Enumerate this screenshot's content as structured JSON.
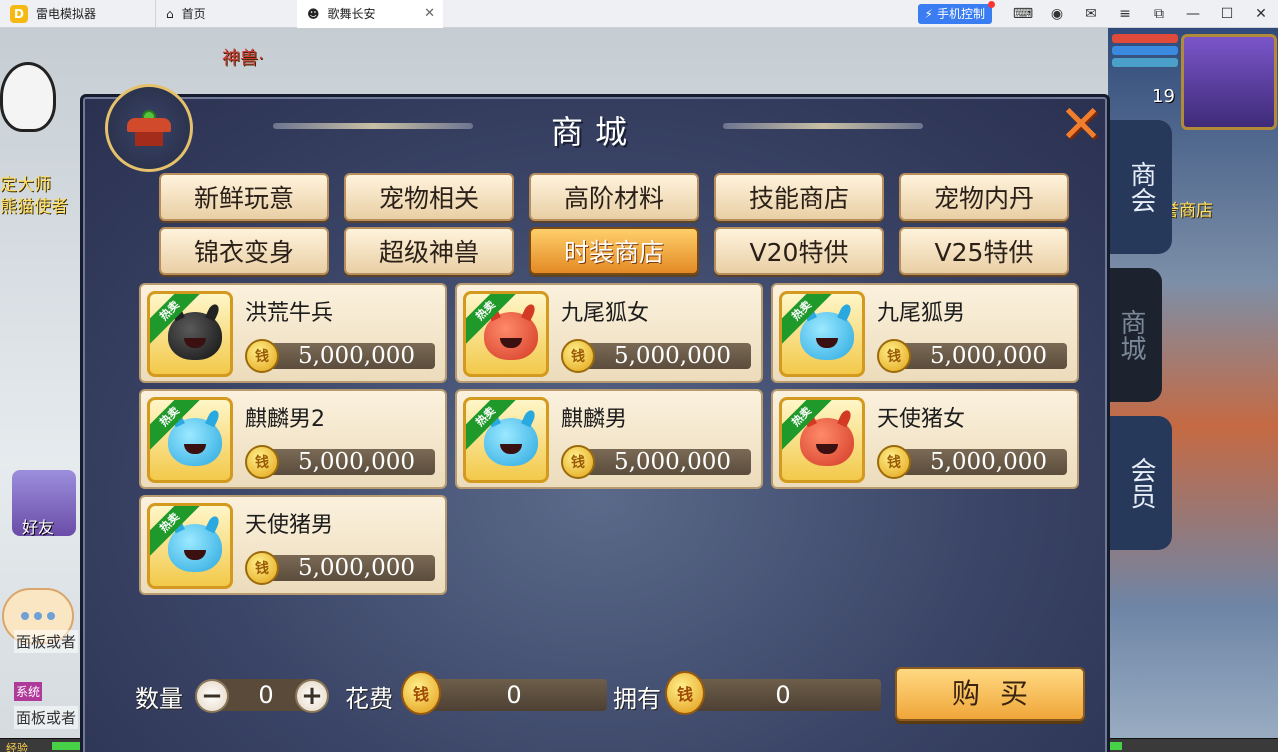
{
  "window": {
    "app_name": "雷电模拟器",
    "tabs": [
      {
        "label": "首页"
      },
      {
        "label": "歌舞长安"
      }
    ],
    "phone_control": "手机控制"
  },
  "game": {
    "npc_left_1": "定大师",
    "npc_left_2": "熊猫使者",
    "npc_top": "神兽·",
    "npc_right": "誉商店",
    "friend_label": "好友",
    "level": "19",
    "exp_label": "经验",
    "chat_line_1": "面板或者",
    "chat_line_2": "面板或者",
    "chat_tag": "系统",
    "side_tabs": [
      {
        "label": "商会"
      },
      {
        "label": "商城"
      },
      {
        "label": "会员"
      }
    ]
  },
  "shop": {
    "title": "商城",
    "categories": [
      {
        "label": "新鲜玩意"
      },
      {
        "label": "宠物相关"
      },
      {
        "label": "高阶材料"
      },
      {
        "label": "技能商店"
      },
      {
        "label": "宠物内丹"
      },
      {
        "label": "锦衣变身"
      },
      {
        "label": "超级神兽"
      },
      {
        "label": "时装商店"
      },
      {
        "label": "V20特供"
      },
      {
        "label": "V25特供"
      }
    ],
    "active_category": "时装商店",
    "hot_badge": "热卖",
    "items": [
      {
        "name": "洪荒牛兵",
        "price": "5,000,000",
        "color": "black"
      },
      {
        "name": "九尾狐女",
        "price": "5,000,000",
        "color": "red"
      },
      {
        "name": "九尾狐男",
        "price": "5,000,000",
        "color": "blue"
      },
      {
        "name": "麒麟男2",
        "price": "5,000,000",
        "color": "blue"
      },
      {
        "name": "麒麟男",
        "price": "5,000,000",
        "color": "blue"
      },
      {
        "name": "天使猪女",
        "price": "5,000,000",
        "color": "red"
      },
      {
        "name": "天使猪男",
        "price": "5,000,000",
        "color": "blue"
      }
    ],
    "quantity_label": "数量",
    "quantity_value": "0",
    "minus_symbol": "−",
    "plus_symbol": "+",
    "cost_label": "花费",
    "cost_value": "0",
    "own_label": "拥有",
    "own_value": "0",
    "buy_label": "购买",
    "coin_glyph": "钱"
  },
  "colors": {
    "active_tab": "#f0a63a",
    "hot_badge": "#1f9a2a",
    "exp_bar": "#46d146"
  }
}
